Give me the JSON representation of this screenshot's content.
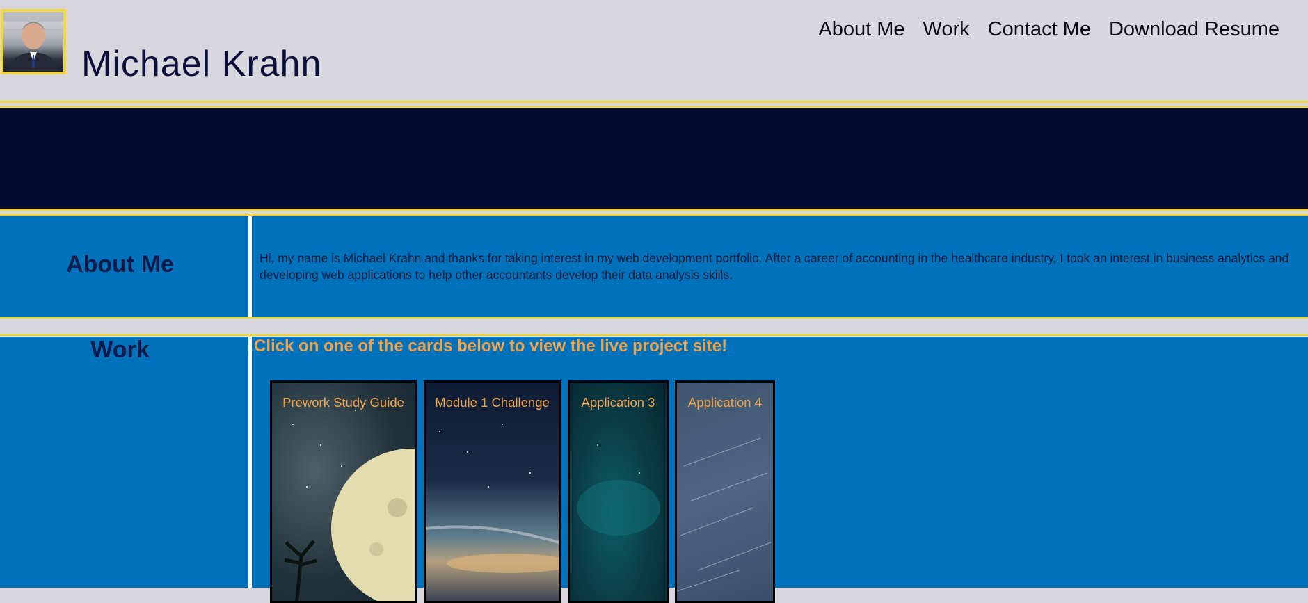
{
  "header": {
    "site_title": "Michael Krahn",
    "nav": [
      "About Me",
      "Work",
      "Contact Me",
      "Download Resume"
    ]
  },
  "about": {
    "heading": "About Me",
    "text": "Hi, my name is Michael Krahn and thanks for taking interest in my web development portfolio. After a career of accounting in the healthcare industry, I took an interest in business analytics and developing web applications to help other accountants develop their data analysis skills."
  },
  "work": {
    "heading": "Work",
    "cta": "Click on one of the cards below to view the live project site!",
    "cards": [
      {
        "title": "Prework Study Guide"
      },
      {
        "title": "Module 1 Challenge"
      },
      {
        "title": "Application 3"
      },
      {
        "title": "Application 4"
      }
    ]
  },
  "colors": {
    "accent_yellow": "#f1d63c",
    "header_bg": "#d8d7de",
    "hero_bg": "#000b2f",
    "section_blue": "#0072bc",
    "card_title_orange": "#f0a24b",
    "heading_navy": "#0b1b4a"
  }
}
